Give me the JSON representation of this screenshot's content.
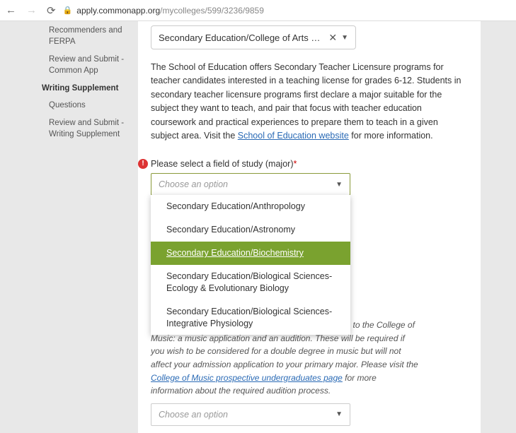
{
  "browser": {
    "url_host": "apply.commonapp.org",
    "url_path": "/mycolleges/599/3236/9859"
  },
  "sidebar": {
    "items": [
      {
        "label": "Recommenders and FERPA",
        "type": "sub"
      },
      {
        "label": "Review and Submit - Common App",
        "type": "sub"
      },
      {
        "label": "Writing Supplement",
        "type": "heading"
      },
      {
        "label": "Questions",
        "type": "sub"
      },
      {
        "label": "Review and Submit - Writing Supplement",
        "type": "sub"
      }
    ]
  },
  "top_select": {
    "value": "Secondary Education/College of Arts & Scie"
  },
  "description": {
    "text_before_link": "The School of Education offers Secondary Teacher Licensure programs for teacher candidates interested in a teaching license for grades 6-12. Students in secondary teacher licensure programs first declare a major suitable for the subject they want to teach, and pair that focus with teacher education coursework and practical experiences to prepare them to teach in a given subject area. Visit the ",
    "link_text": "School of Education website",
    "text_after_link": " for more information."
  },
  "field": {
    "label": "Please select a field of study (major)",
    "placeholder": "Choose an option",
    "options": [
      "Secondary Education/Anthropology",
      "Secondary Education/Astronomy",
      "Secondary Education/Biochemistry",
      "Secondary Education/Biological Sciences-Ecology & Evolutionary Biology",
      "Secondary Education/Biological Sciences-Integrative Physiology"
    ]
  },
  "note": {
    "text_before_link": "need to be completed to be considered for admission to the College of Music: a music application and an audition. These will be required if you wish to be considered for a double degree in music but will not affect your admission application to your primary major. Please visit the ",
    "link_text": "College of Music prospective undergraduates page",
    "text_after_link": " for more information about the required audition process."
  },
  "bottom_select": {
    "placeholder": "Choose an option"
  }
}
